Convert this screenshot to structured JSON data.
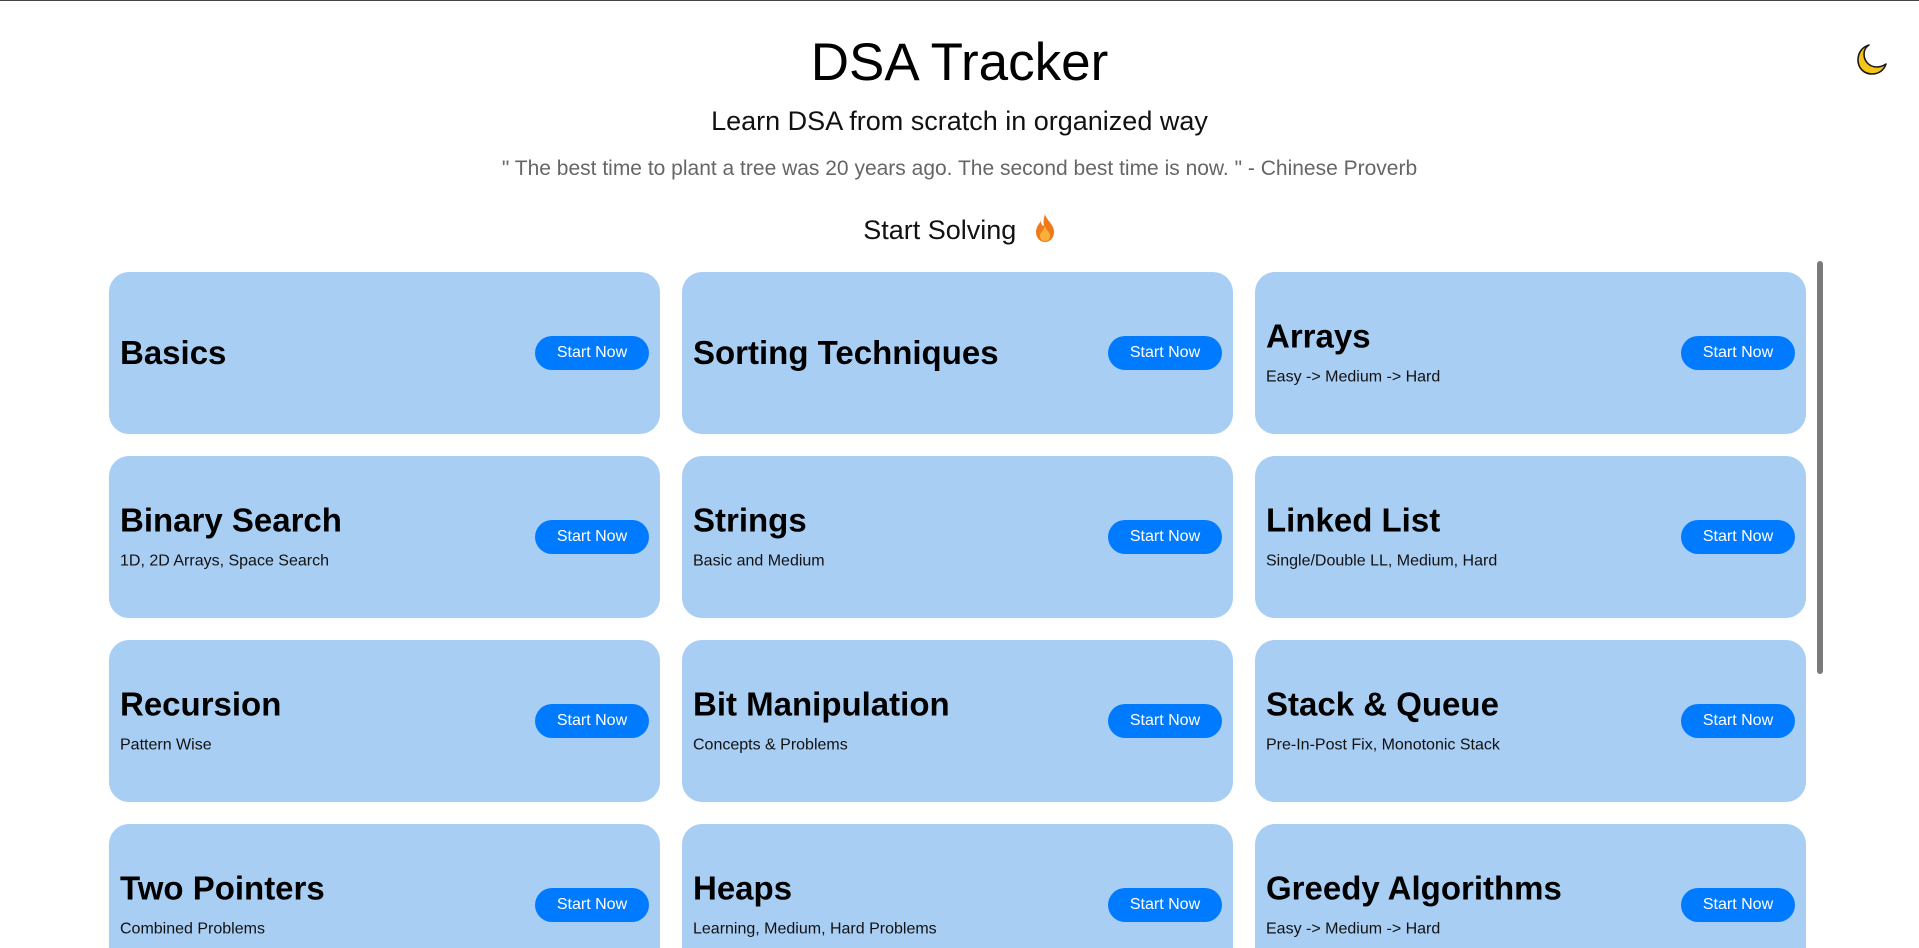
{
  "header": {
    "title": "DSA Tracker",
    "tagline": "Learn DSA from scratch in organized way",
    "quote": "\" The best time to plant a tree was 20 years ago. The second best time is now. \" - Chinese Proverb",
    "start_solving": "Start Solving"
  },
  "icons": {
    "theme_toggle": "moon-icon",
    "start_solving": "fire-icon"
  },
  "colors": {
    "card_background": "#a9cef4",
    "button_background": "#007bff",
    "button_text": "#ffffff",
    "moon": "#f5c518",
    "moon_outline": "#1a1a1a",
    "fire_outer": "#f07a1a",
    "fire_inner": "#fbb03b",
    "quote_text": "#666666"
  },
  "cards": [
    {
      "title": "Basics",
      "subtitle": "",
      "button": "Start Now"
    },
    {
      "title": "Sorting Techniques",
      "subtitle": "",
      "button": "Start Now"
    },
    {
      "title": "Arrays",
      "subtitle": "Easy -> Medium -> Hard",
      "button": "Start Now"
    },
    {
      "title": "Binary Search",
      "subtitle": "1D, 2D Arrays, Space Search",
      "button": "Start Now"
    },
    {
      "title": "Strings",
      "subtitle": "Basic and Medium",
      "button": "Start Now"
    },
    {
      "title": "Linked List",
      "subtitle": "Single/Double LL, Medium, Hard",
      "button": "Start Now"
    },
    {
      "title": "Recursion",
      "subtitle": "Pattern Wise",
      "button": "Start Now"
    },
    {
      "title": "Bit Manipulation",
      "subtitle": "Concepts & Problems",
      "button": "Start Now"
    },
    {
      "title": "Stack & Queue",
      "subtitle": "Pre-In-Post Fix, Monotonic Stack",
      "button": "Start Now"
    },
    {
      "title": "Two Pointers",
      "subtitle": "Combined Problems",
      "button": "Start Now"
    },
    {
      "title": "Heaps",
      "subtitle": "Learning, Medium, Hard Problems",
      "button": "Start Now"
    },
    {
      "title": "Greedy Algorithms",
      "subtitle": "Easy -> Medium -> Hard",
      "button": "Start Now"
    }
  ]
}
